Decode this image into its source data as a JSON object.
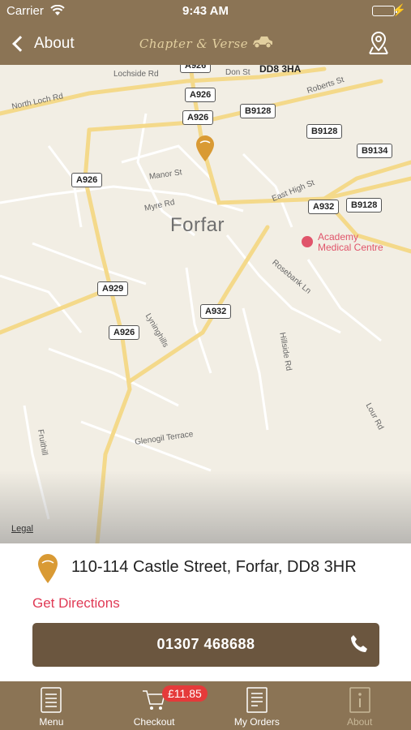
{
  "status_bar": {
    "carrier": "Carrier",
    "time": "9:43 AM"
  },
  "nav": {
    "back_label": "About",
    "logo_text": "Chapter & Verse"
  },
  "map": {
    "place": "Forfar",
    "postcode": "DD8 3HA",
    "poi": {
      "name_line1": "Academy",
      "name_line2": "Medical Centre"
    },
    "roads": {
      "north_loch": "North Loch Rd",
      "lochside": "Lochside Rd",
      "don": "Don St",
      "roberts": "Roberts St",
      "manor": "Manor St",
      "myre": "Myre Rd",
      "east_high": "East High St",
      "rosebank": "Rosebank Ln",
      "lyninghills": "Lyninghills",
      "hillside": "Hillside Rd",
      "lour": "Lour Rd",
      "fruithill": "Fruithill",
      "glenogil": "Glenogil Terrace"
    },
    "shields": {
      "a926_top": "A926",
      "a926_a": "A926",
      "a926_b": "A926",
      "b9128_a": "B9128",
      "b9128_b": "B9128",
      "b9134": "B9134",
      "a926_left": "A926",
      "a932_a": "A932",
      "b9128_c": "B9128",
      "a929": "A929",
      "a932_b": "A932",
      "a926_low": "A926"
    },
    "legal": "Legal"
  },
  "info": {
    "address": "110-114 Castle Street, Forfar, DD8 3HR",
    "directions": "Get Directions",
    "phone": "01307 468688"
  },
  "tabs": [
    {
      "label": "Menu"
    },
    {
      "label": "Checkout"
    },
    {
      "label": "My Orders"
    },
    {
      "label": "About"
    }
  ],
  "cart_badge": "£11.85",
  "colors": {
    "bar": "#8b7455",
    "button": "#6b563f",
    "accent": "#e03a55",
    "pin": "#d99a34"
  }
}
